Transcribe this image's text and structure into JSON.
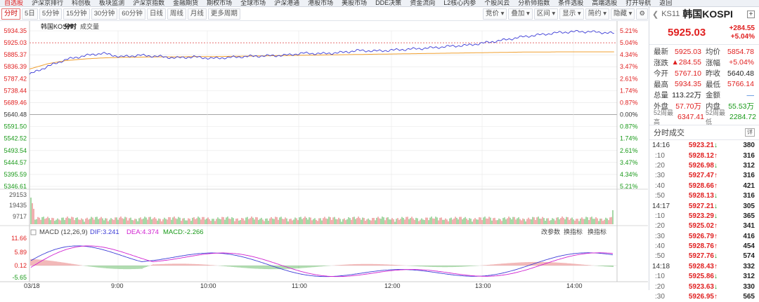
{
  "topnav": {
    "items": [
      "自选股",
      "沪深京排行",
      "科创板",
      "板块监测",
      "沪深京指数",
      "金融期货",
      "期权市场",
      "全球市场",
      "沪深港通",
      "港股市场",
      "美股市场",
      "DDE决策",
      "资金流向",
      "L2核心内参",
      "个股风云",
      "分析师指数",
      "条件选股",
      "高端选股",
      "打开导航",
      "返回"
    ]
  },
  "toolbar": {
    "left": [
      "分时",
      "5日",
      "5分钟",
      "15分钟",
      "30分钟",
      "60分钟",
      "日线",
      "周线",
      "月线",
      "更多周期"
    ],
    "active": "分时",
    "right": [
      "竞价",
      "叠加",
      "区间",
      "显示",
      "简约",
      "隐藏"
    ]
  },
  "chart_header": {
    "name": "韩国KOSPI",
    "tab1": "分时",
    "tab2": "成交量"
  },
  "price_axis": {
    "left_labels": [
      "5934.35",
      "5925.03",
      "5885.37",
      "5836.39",
      "5787.42",
      "5738.44",
      "5689.46",
      "5640.48",
      "5591.50",
      "5542.52",
      "5493.54",
      "5444.57",
      "5395.59",
      "5346.61"
    ],
    "right_labels": [
      "5.21%",
      "5.04%",
      "4.34%",
      "3.47%",
      "2.61%",
      "1.74%",
      "0.87%",
      "0.00%",
      "0.87%",
      "1.74%",
      "2.61%",
      "3.47%",
      "4.34%",
      "5.21%"
    ]
  },
  "volume_axis": {
    "labels": [
      "29153",
      "19435",
      "9717"
    ]
  },
  "macd": {
    "title": "MACD (12,26,9)",
    "dif": "DIF:3.241",
    "dea": "DEA:4.374",
    "macd": "MACD:-2.266",
    "labels": [
      "11.66",
      "5.89",
      "0.12",
      "-5.65"
    ],
    "buttons": [
      "改参数",
      "换指标",
      "换指标"
    ]
  },
  "time_axis": {
    "labels": [
      "03/18",
      "9:00",
      "10:00",
      "11:00",
      "12:00",
      "13:00",
      "14:00"
    ]
  },
  "colors": {
    "up": "#e02020",
    "down": "#1a9a1a",
    "price_line": "#3b3bd6",
    "avg_line": "#f0a030"
  },
  "chart_data": {
    "type": "line",
    "title": "韩国KOSPI",
    "series": [
      {
        "name": "分时",
        "values": [
          5770,
          5800,
          5826,
          5840,
          5850,
          5836,
          5842,
          5838,
          5832,
          5836,
          5830,
          5834,
          5838,
          5840,
          5842,
          5850,
          5848,
          5852,
          5860,
          5858,
          5862,
          5866,
          5870,
          5876,
          5880,
          5890,
          5900,
          5912,
          5920,
          5928,
          5932,
          5930,
          5925
        ]
      },
      {
        "name": "均价",
        "values": [
          5790,
          5810,
          5822,
          5828,
          5832,
          5834,
          5835,
          5836,
          5836,
          5837,
          5837,
          5838,
          5839,
          5840,
          5841,
          5842,
          5843,
          5844,
          5845,
          5846,
          5847,
          5848,
          5849,
          5850,
          5851,
          5852,
          5853,
          5854,
          5854,
          5855,
          5855,
          5855,
          5855
        ]
      }
    ],
    "ylim": [
      5346.61,
      5934.35
    ]
  },
  "right_panel": {
    "code_label": "KS11",
    "name": "韩国KOSPI",
    "price": "5925.03",
    "change": "+284.55",
    "change_pct": "+5.04%",
    "quote_rows": [
      {
        "k1": "最新",
        "v1": "5925.03",
        "c1": "red",
        "k2": "均价",
        "v2": "5854.78",
        "c2": "red"
      },
      {
        "k1": "涨跌",
        "v1": "▲284.55",
        "c1": "red",
        "k2": "涨幅",
        "v2": "+5.04%",
        "c2": "red"
      },
      {
        "k1": "今开",
        "v1": "5767.10",
        "c1": "red",
        "k2": "昨收",
        "v2": "5640.48",
        "c2": "dark"
      },
      {
        "k1": "最高",
        "v1": "5934.35",
        "c1": "red",
        "k2": "最低",
        "v2": "5766.14",
        "c2": "red"
      },
      {
        "k1": "总量",
        "v1": "113.22万",
        "c1": "dark",
        "k2": "金额",
        "v2": "—",
        "c2": "blue"
      },
      {
        "k1": "外盘",
        "v1": "57.70万",
        "c1": "red",
        "k2": "内盘",
        "v2": "55.53万",
        "c2": "green"
      }
    ],
    "week52": {
      "k1": "52周最高",
      "v1": "6347.41",
      "k2": "52周最低",
      "v2": "2284.72"
    },
    "ticks_title": "分时成交",
    "ticks_expand": "详",
    "ticks": [
      {
        "t": "14:16",
        "p": "5923.21",
        "a": "↓",
        "v": "380"
      },
      {
        "t": ":10",
        "p": "5928.12",
        "a": "↑",
        "v": "316"
      },
      {
        "t": ":20",
        "p": "5926.98",
        "a": "↓",
        "v": "312"
      },
      {
        "t": ":30",
        "p": "5927.47",
        "a": "↑",
        "v": "316"
      },
      {
        "t": ":40",
        "p": "5928.66",
        "a": "↑",
        "v": "421"
      },
      {
        "t": ":50",
        "p": "5928.13",
        "a": "↓",
        "v": "316"
      },
      {
        "t": "14:17",
        "p": "5927.21",
        "a": "↓",
        "v": "305"
      },
      {
        "t": ":10",
        "p": "5923.29",
        "a": "↓",
        "v": "365"
      },
      {
        "t": ":20",
        "p": "5925.02",
        "a": "↑",
        "v": "341"
      },
      {
        "t": ":30",
        "p": "5926.79",
        "a": "↑",
        "v": "416"
      },
      {
        "t": ":40",
        "p": "5928.76",
        "a": "↑",
        "v": "454"
      },
      {
        "t": ":50",
        "p": "5927.76",
        "a": "↓",
        "v": "574"
      },
      {
        "t": "14:18",
        "p": "5928.43",
        "a": "↑",
        "v": "332"
      },
      {
        "t": ":10",
        "p": "5925.86",
        "a": "↓",
        "v": "312"
      },
      {
        "t": ":20",
        "p": "5923.63",
        "a": "↓",
        "v": "330"
      },
      {
        "t": ":30",
        "p": "5926.95",
        "a": "↑",
        "v": "565"
      }
    ]
  }
}
